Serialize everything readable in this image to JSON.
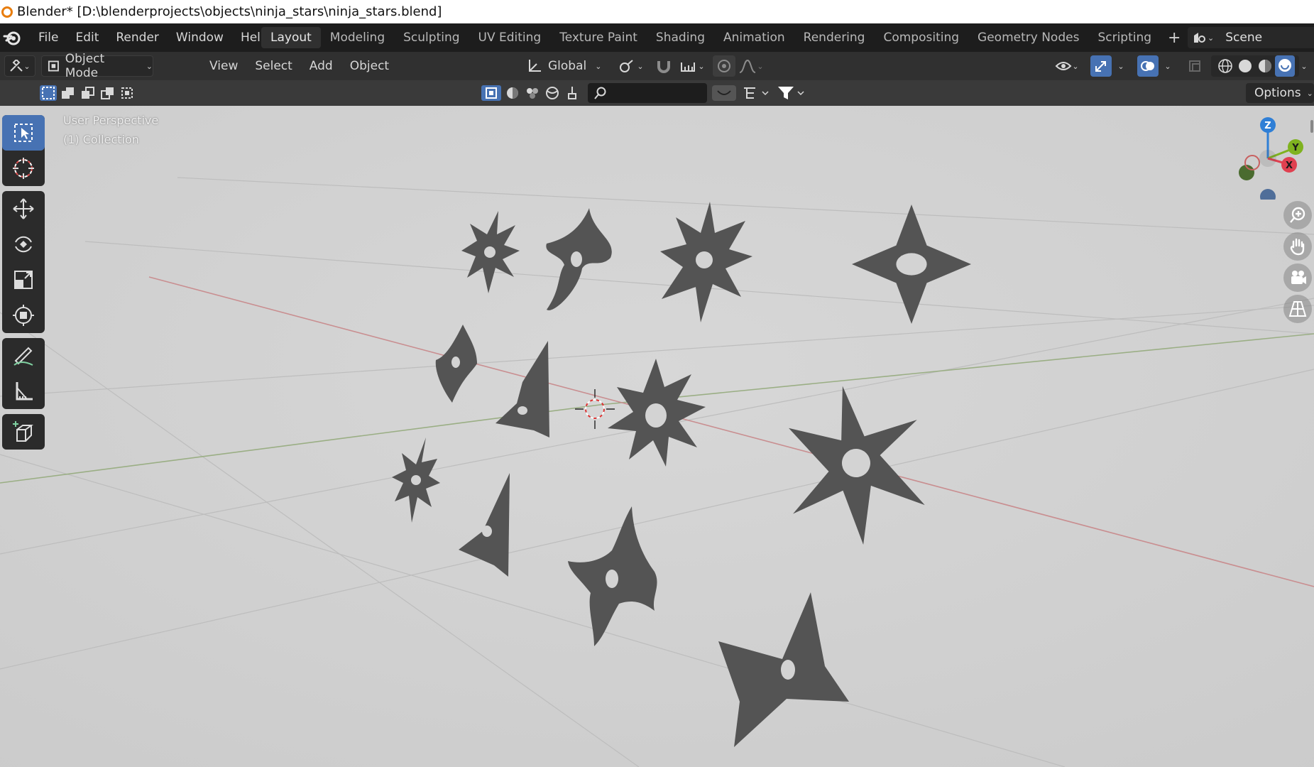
{
  "window_title": "Blender* [D:\\blenderprojects\\objects\\ninja_stars\\ninja_stars.blend]",
  "menus": [
    "File",
    "Edit",
    "Render",
    "Window",
    "Help"
  ],
  "workspaces": [
    "Layout",
    "Modeling",
    "Sculpting",
    "UV Editing",
    "Texture Paint",
    "Shading",
    "Animation",
    "Rendering",
    "Compositing",
    "Geometry Nodes",
    "Scripting"
  ],
  "active_workspace": "Layout",
  "add_workspace_icon": "+",
  "scene_name": "Scene",
  "header": {
    "mode": "Object Mode",
    "menus": [
      "View",
      "Select",
      "Add",
      "Object"
    ],
    "transform_orientation": "Global"
  },
  "toolbar2": {
    "options_label": "Options",
    "search_placeholder": ""
  },
  "viewport": {
    "view_name": "User Perspective",
    "collection": "(1) Collection"
  },
  "gizmo": {
    "z": "Z",
    "y": "Y",
    "x": "X"
  },
  "colors": {
    "accent": "#4772b3",
    "axis_x": "#e04050",
    "axis_y": "#7fb21f",
    "axis_z": "#2f7fd6",
    "logo": "#e87d0d"
  },
  "left_tools": [
    "select-box-icon",
    "cursor-icon",
    "move-icon",
    "rotate-icon",
    "scale-icon",
    "transform-icon",
    "annotate-icon",
    "measure-icon",
    "add-cube-icon"
  ],
  "nav_icons": [
    "zoom-icon",
    "pan-hand-icon",
    "camera-icon",
    "grid-view-icon"
  ]
}
